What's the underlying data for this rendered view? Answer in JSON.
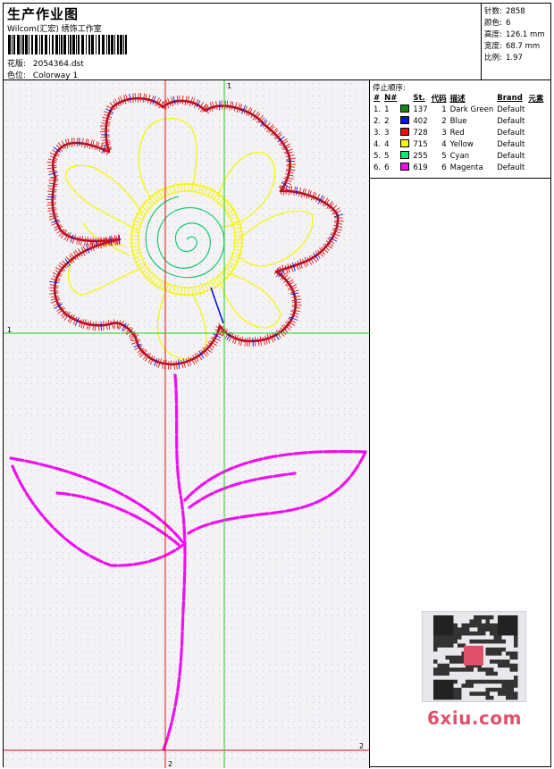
{
  "header": {
    "title": "生产作业图",
    "studio": "Wilcom(汇宏) 绣饰工作室",
    "design_label": "花版:",
    "design_file": "2054364.dst",
    "colorway_label": "色位:",
    "colorway": "Colorway 1"
  },
  "stats": [
    {
      "label": "针数:",
      "value": "2858"
    },
    {
      "label": "颜色:",
      "value": "6"
    },
    {
      "label": "高度:",
      "value": "126.1 mm"
    },
    {
      "label": "宽度:",
      "value": "68.7 mm"
    },
    {
      "label": "比例:",
      "value": "1.97"
    }
  ],
  "sequence": {
    "title": "停止顺序:",
    "columns": [
      "#",
      "N#",
      "St.",
      "代码",
      "描述",
      "Brand",
      "元素"
    ],
    "rows": [
      {
        "idx": "1.",
        "n": "1",
        "color": "#138a13",
        "st": "137",
        "code": "1",
        "desc": "Dark Green",
        "brand": "Default"
      },
      {
        "idx": "2.",
        "n": "2",
        "color": "#0a14e6",
        "st": "402",
        "code": "2",
        "desc": "Blue",
        "brand": "Default"
      },
      {
        "idx": "3.",
        "n": "3",
        "color": "#e60f0f",
        "st": "728",
        "code": "3",
        "desc": "Red",
        "brand": "Default"
      },
      {
        "idx": "4.",
        "n": "4",
        "color": "#f5f50a",
        "st": "715",
        "code": "4",
        "desc": "Yellow",
        "brand": "Default"
      },
      {
        "idx": "5.",
        "n": "5",
        "color": "#14e678",
        "st": "255",
        "code": "5",
        "desc": "Cyan",
        "brand": "Default"
      },
      {
        "idx": "6.",
        "n": "6",
        "color": "#ee0fee",
        "st": "619",
        "code": "6",
        "desc": "Magenta",
        "brand": "Default"
      }
    ]
  },
  "guides": {
    "vertical_1": "1",
    "horizontal_1": "1",
    "vertical_2": "2",
    "horizontal_2": "2"
  },
  "watermark": {
    "site": "6xiu.com"
  },
  "colors": {
    "guide_red": "#e01010",
    "guide_green": "#20d020",
    "petal_outline": "#a01030",
    "petal_stitch": "#e01515",
    "center_green": "#18c870",
    "stem": "#ee10ee"
  }
}
